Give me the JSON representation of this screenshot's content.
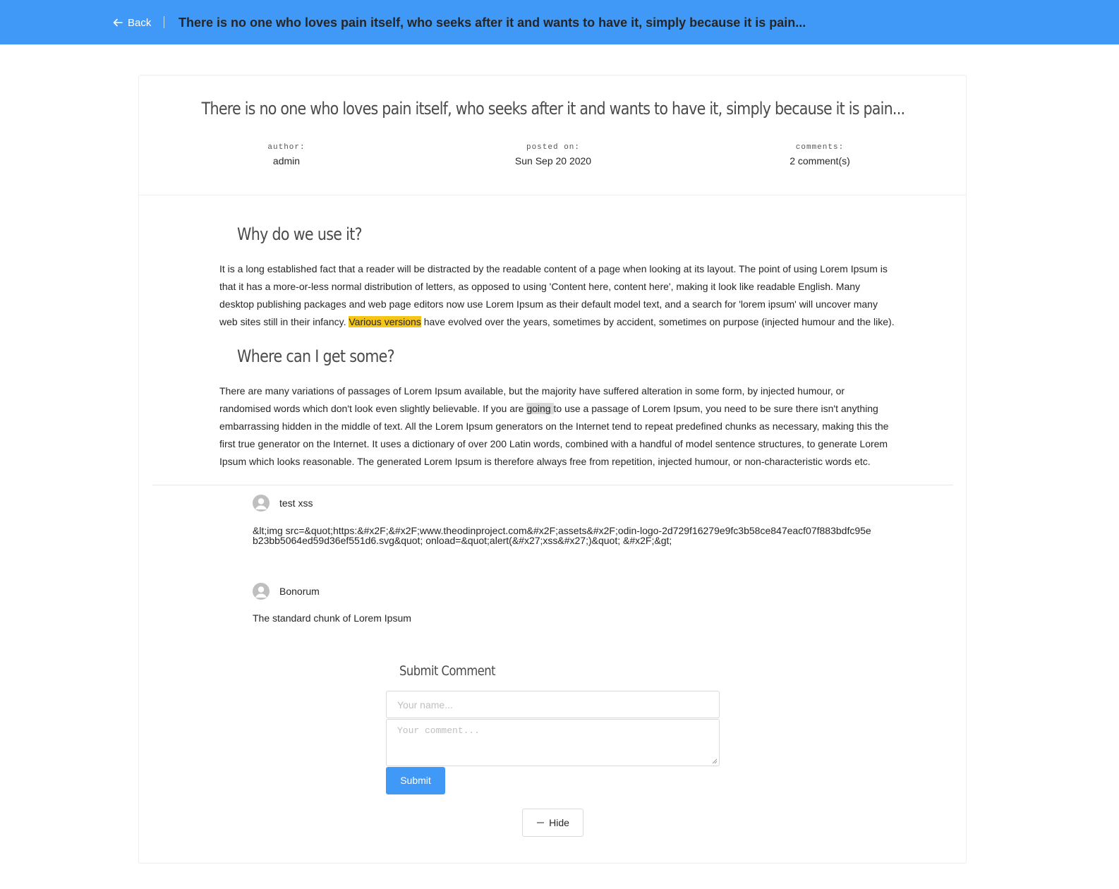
{
  "header": {
    "back_label": "Back",
    "title": "There is no one who loves pain itself, who seeks after it and wants to have it, simply because it is pain..."
  },
  "post": {
    "title": "There is no one who loves pain itself, who seeks after it and wants to have it, simply because it is pain...",
    "meta": {
      "author_label": "author:",
      "author": "admin",
      "posted_label": "posted on:",
      "posted": "Sun Sep 20 2020",
      "comments_label": "comments:",
      "comments": "2 comment(s)"
    },
    "sections": [
      {
        "heading": "Why do we use it?",
        "text_before": "It is a long established fact that a reader will be distracted by the readable content of a page when looking at its layout. The point of using Lorem Ipsum is that it has a more-or-less normal distribution of letters, as opposed to using 'Content here, content here', making it look like readable English. Many desktop publishing packages and web page editors now use Lorem Ipsum as their default model text, and a search for 'lorem ipsum' will uncover many web sites still in their infancy. ",
        "highlight": "Various versions",
        "text_after": " have evolved over the years, sometimes by accident, sometimes on purpose (injected humour and the like)."
      },
      {
        "heading": "Where can I get some?",
        "text_before": "There are many variations of passages of Lorem Ipsum available, but the majority have suffered alteration in some form, by injected humour, or randomised words which don't look even slightly believable. If you are ",
        "highlight": "going ",
        "text_after": "to use a passage of Lorem Ipsum, you need to be sure there isn't anything embarrassing hidden in the middle of text. All the Lorem Ipsum generators on the Internet tend to repeat predefined chunks as necessary, making this the first true generator on the Internet. It uses a dictionary of over 200 Latin words, combined with a handful of model sentence structures, to generate Lorem Ipsum which looks reasonable. The generated Lorem Ipsum is therefore always free from repetition, injected humour, or non-characteristic words etc."
      }
    ]
  },
  "comments": [
    {
      "author": "test xss",
      "body": "&lt;img src=&quot;https:&#x2F;&#x2F;www.theodinproject.com&#x2F;assets&#x2F;odin-logo-2d729f16279e9fc3b58ce847eacf07f883bdfc95eb23bb5064ed59d36ef551d6.svg&quot; onload=&quot;alert(&#x27;xss&#x27;)&quot; &#x2F;&gt;"
    },
    {
      "author": "Bonorum",
      "body": "The standard chunk of Lorem Ipsum"
    }
  ],
  "form": {
    "title": "Submit Comment",
    "name_placeholder": "Your name...",
    "comment_placeholder": "Your comment...",
    "submit_label": "Submit"
  },
  "hide_label": "Hide",
  "colors": {
    "accent": "#4199f7",
    "highlight": "#f5c518"
  }
}
